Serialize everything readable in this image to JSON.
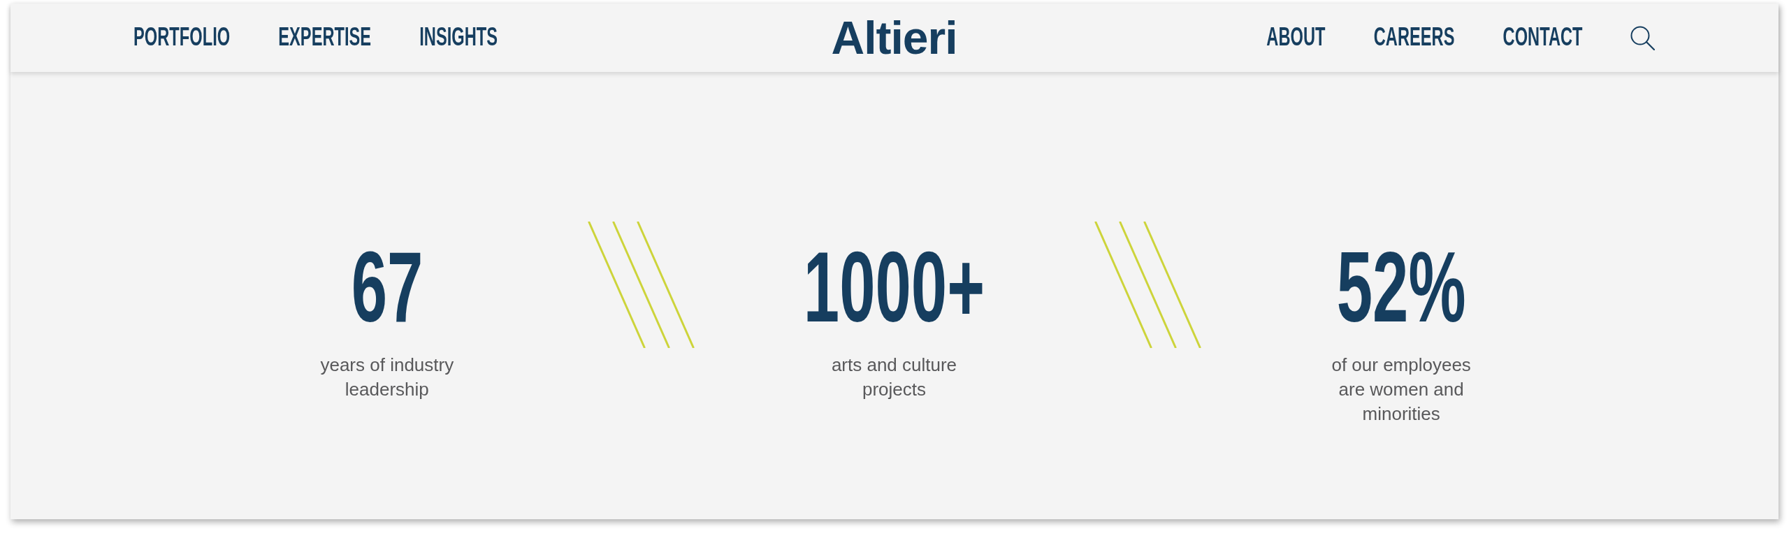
{
  "header": {
    "nav_left": [
      "PORTFOLIO",
      "EXPERTISE",
      "INSIGHTS"
    ],
    "logo": "Altieri",
    "nav_right": [
      "ABOUT",
      "CAREERS",
      "CONTACT"
    ]
  },
  "stats": [
    {
      "value": "67",
      "label": "years of industry leadership"
    },
    {
      "value": "1000+",
      "label": "arts and culture projects"
    },
    {
      "value": "52%",
      "label": "of our employees are women and minorities"
    }
  ]
}
